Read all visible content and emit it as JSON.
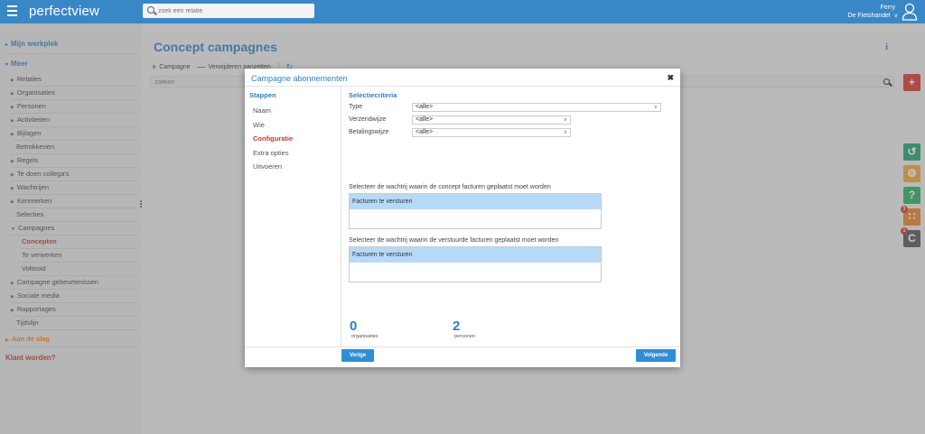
{
  "topbar": {
    "brand": "perfectview",
    "search_placeholder": "zoek een relatie",
    "user_name": "Ferry",
    "user_org": "De Fietshandel"
  },
  "sidebar": {
    "mijn_werkplek": "Mijn werkplek",
    "meer": "Meer",
    "items": [
      {
        "label": "Relaties",
        "arrow": true
      },
      {
        "label": "Organisaties",
        "arrow": true
      },
      {
        "label": "Personen",
        "arrow": true
      },
      {
        "label": "Activiteiten",
        "arrow": true
      },
      {
        "label": "Bijlagen",
        "arrow": true
      },
      {
        "label": "Betrokkenen",
        "arrow": false
      },
      {
        "label": "Regels",
        "arrow": true
      },
      {
        "label": "Te doen collega's",
        "arrow": true
      },
      {
        "label": "Wachtrijen",
        "arrow": true
      },
      {
        "label": "Kenmerken",
        "arrow": true
      },
      {
        "label": "Selecties",
        "arrow": false
      },
      {
        "label": "Campagnes",
        "arrow": true
      },
      {
        "label": "Concepten",
        "sub": true,
        "active": true
      },
      {
        "label": "Te verwerken",
        "sub": true
      },
      {
        "label": "Voltooid",
        "sub": true
      },
      {
        "label": "Campagne gebeurtenissen",
        "arrow": true
      },
      {
        "label": "Sociale media",
        "arrow": true
      },
      {
        "label": "Rapportages",
        "arrow": true
      },
      {
        "label": "Tijdslijn",
        "arrow": false
      }
    ],
    "aan_de_slag": "Aan de slag",
    "klant_worden": "Klant worden?"
  },
  "main": {
    "title": "Concept campagnes",
    "toolbar": {
      "campagne": "Campagne",
      "verwijderen": "Verwijderen aanzetten"
    },
    "search_placeholder": "zoeken"
  },
  "rail": {
    "badge_rss": "3",
    "badge_c": "1",
    "colors": {
      "add": "#d9342b",
      "history": "#1f9e6e",
      "settings": "#e8a33d",
      "help": "#2eac5f",
      "rss": "#e67e22",
      "c": "#555555"
    }
  },
  "modal": {
    "title": "Campagne abonnementen",
    "steps_header": "Stappen",
    "steps": [
      {
        "label": "Naam",
        "current": false
      },
      {
        "label": "Wie",
        "current": false
      },
      {
        "label": "Configuratie",
        "current": true
      },
      {
        "label": "Extra opties",
        "current": false
      },
      {
        "label": "Uitvoeren",
        "current": false
      }
    ],
    "criteria_header": "Selectiecriteria",
    "fields": [
      {
        "label": "Type",
        "value": "<alle>"
      },
      {
        "label": "Verzendwijze",
        "value": "<alle>"
      },
      {
        "label": "Betalingswijze",
        "value": "<alle>"
      }
    ],
    "queue1": {
      "label": "Selecteer de wachtrij waarin de concept facturen geplaatst moet worden",
      "option": "Facturen te versturen"
    },
    "queue2": {
      "label": "Selecteer de wachtrij waarin de verstuurde facturen geplaatst moet worden",
      "option": "Facturen te versturen"
    },
    "stats": {
      "organisaties_count": "0",
      "organisaties_label": "organisaties",
      "personen_count": "2",
      "personen_label": "personen"
    },
    "buttons": {
      "prev": "Vorige",
      "next": "Volgende"
    }
  },
  "accent": "#2f7fc2"
}
